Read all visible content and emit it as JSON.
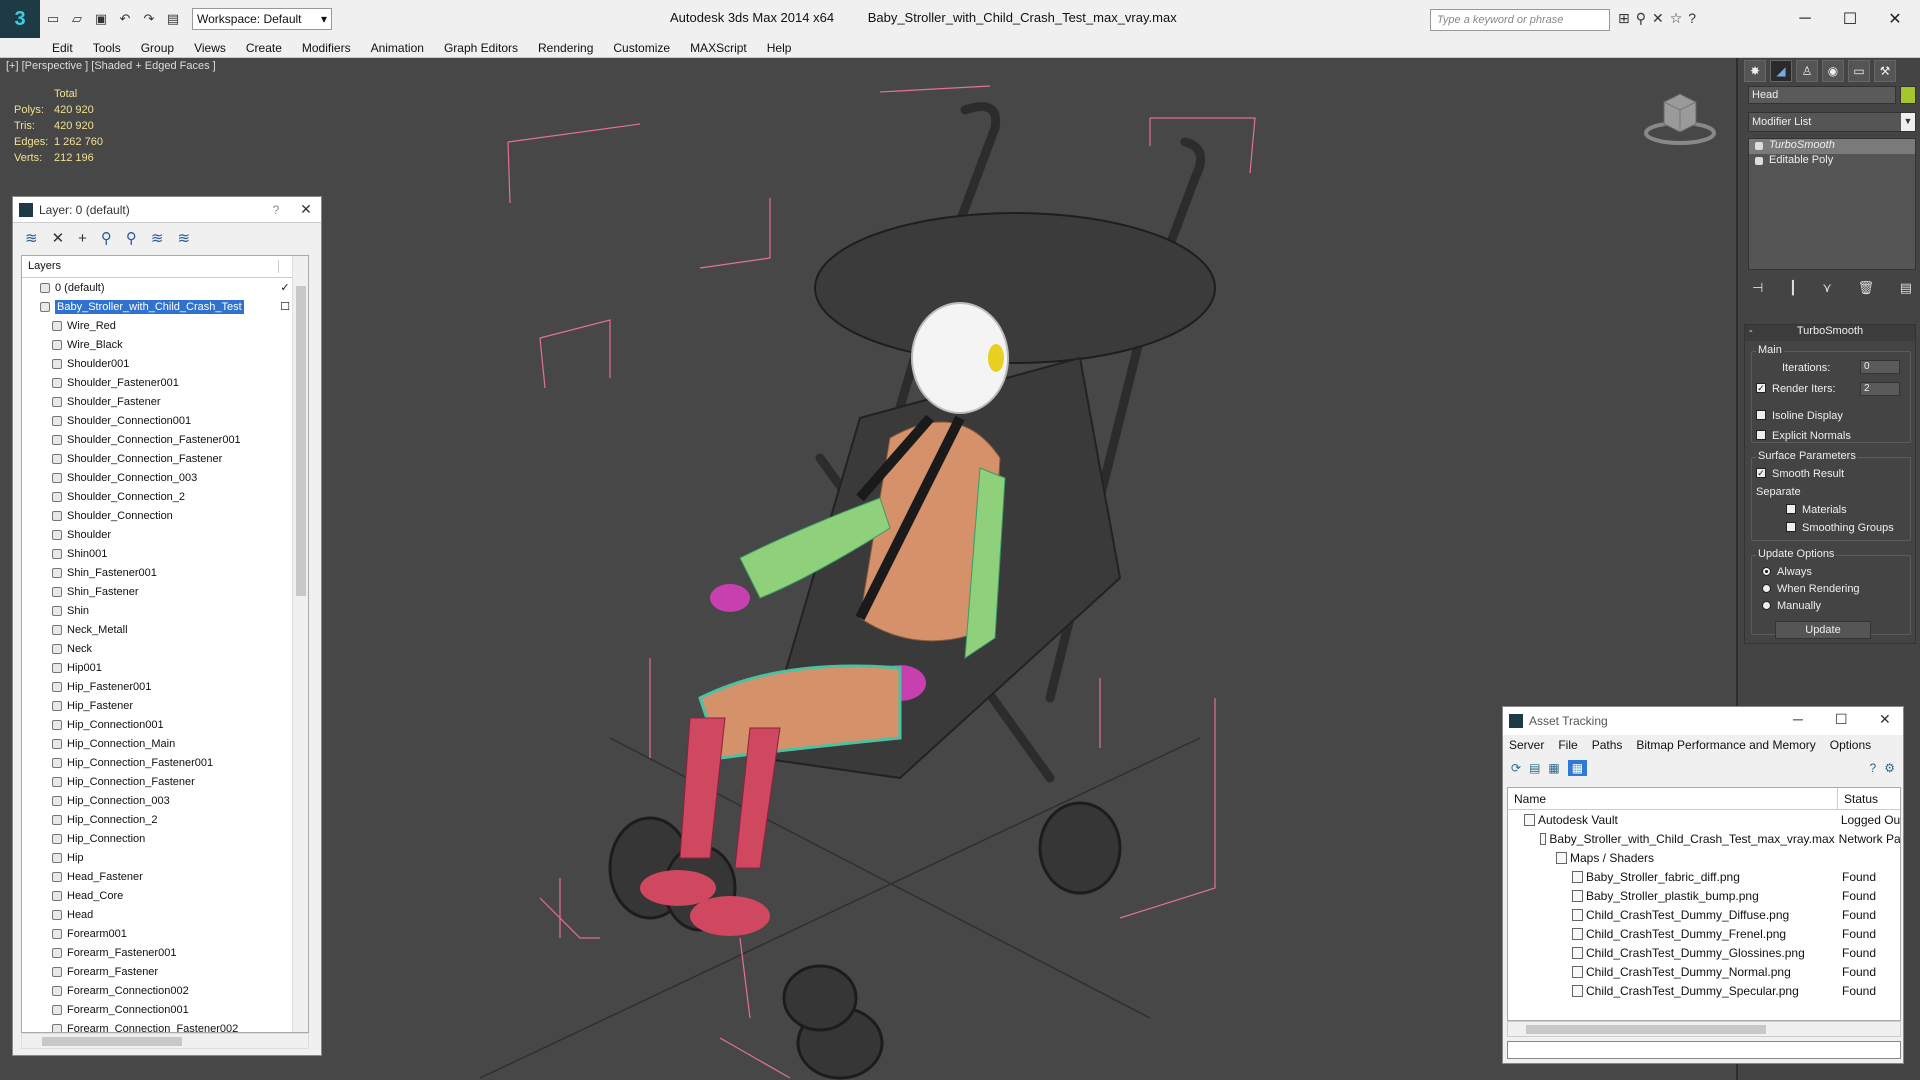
{
  "titlebar": {
    "workspace": "Workspace: Default",
    "app_name": "Autodesk 3ds Max  2014 x64",
    "file_name": "Baby_Stroller_with_Child_Crash_Test_max_vray.max",
    "search_placeholder": "Type a keyword or phrase"
  },
  "menu": [
    "Edit",
    "Tools",
    "Group",
    "Views",
    "Create",
    "Modifiers",
    "Animation",
    "Graph Editors",
    "Rendering",
    "Customize",
    "MAXScript",
    "Help"
  ],
  "viewport": {
    "label": "[+] [Perspective ] [Shaded + Edged Faces ]",
    "stats_header": "Total",
    "stats": [
      {
        "k": "Polys:",
        "v": "420 920"
      },
      {
        "k": "Tris:",
        "v": "420 920"
      },
      {
        "k": "Edges:",
        "v": "1 262 760"
      },
      {
        "k": "Verts:",
        "v": "212 196"
      }
    ]
  },
  "layer_panel": {
    "title": "Layer: 0 (default)",
    "help": "?",
    "column": "Layers",
    "items": [
      {
        "label": "0 (default)",
        "level": 1,
        "check": "✓"
      },
      {
        "label": "Baby_Stroller_with_Child_Crash_Test",
        "level": 1,
        "selected": true,
        "check": "☐"
      },
      {
        "label": "Wire_Red",
        "level": 2
      },
      {
        "label": "Wire_Black",
        "level": 2
      },
      {
        "label": "Shoulder001",
        "level": 2
      },
      {
        "label": "Shoulder_Fastener001",
        "level": 2
      },
      {
        "label": "Shoulder_Fastener",
        "level": 2
      },
      {
        "label": "Shoulder_Connection001",
        "level": 2
      },
      {
        "label": "Shoulder_Connection_Fastener001",
        "level": 2
      },
      {
        "label": "Shoulder_Connection_Fastener",
        "level": 2
      },
      {
        "label": "Shoulder_Connection_003",
        "level": 2
      },
      {
        "label": "Shoulder_Connection_2",
        "level": 2
      },
      {
        "label": "Shoulder_Connection",
        "level": 2
      },
      {
        "label": "Shoulder",
        "level": 2
      },
      {
        "label": "Shin001",
        "level": 2
      },
      {
        "label": "Shin_Fastener001",
        "level": 2
      },
      {
        "label": "Shin_Fastener",
        "level": 2
      },
      {
        "label": "Shin",
        "level": 2
      },
      {
        "label": "Neck_Metall",
        "level": 2
      },
      {
        "label": "Neck",
        "level": 2
      },
      {
        "label": "Hip001",
        "level": 2
      },
      {
        "label": "Hip_Fastener001",
        "level": 2
      },
      {
        "label": "Hip_Fastener",
        "level": 2
      },
      {
        "label": "Hip_Connection001",
        "level": 2
      },
      {
        "label": "Hip_Connection_Main",
        "level": 2
      },
      {
        "label": "Hip_Connection_Fastener001",
        "level": 2
      },
      {
        "label": "Hip_Connection_Fastener",
        "level": 2
      },
      {
        "label": "Hip_Connection_003",
        "level": 2
      },
      {
        "label": "Hip_Connection_2",
        "level": 2
      },
      {
        "label": "Hip_Connection",
        "level": 2
      },
      {
        "label": "Hip",
        "level": 2
      },
      {
        "label": "Head_Fastener",
        "level": 2
      },
      {
        "label": "Head_Core",
        "level": 2
      },
      {
        "label": "Head",
        "level": 2
      },
      {
        "label": "Forearm001",
        "level": 2
      },
      {
        "label": "Forearm_Fastener001",
        "level": 2
      },
      {
        "label": "Forearm_Fastener",
        "level": 2
      },
      {
        "label": "Forearm_Connection002",
        "level": 2
      },
      {
        "label": "Forearm_Connection001",
        "level": 2
      },
      {
        "label": "Forearm_Connection_Fastener002",
        "level": 2
      }
    ]
  },
  "command_panel": {
    "object_name": "Head",
    "object_color": "#a3c62a",
    "modifier_list": "Modifier List",
    "stack": [
      "TurboSmooth",
      "Editable Poly"
    ],
    "rollout_title": "TurboSmooth",
    "main_label": "Main",
    "iterations_label": "Iterations:",
    "iterations": "0",
    "render_iters_label": "Render Iters:",
    "render_iters": "2",
    "isoline": "Isoline Display",
    "explicit_normals": "Explicit Normals",
    "surface_params": "Surface Parameters",
    "smooth_result": "Smooth Result",
    "separate": "Separate",
    "materials": "Materials",
    "smoothing_groups": "Smoothing Groups",
    "update_options": "Update Options",
    "always": "Always",
    "when_rendering": "When Rendering",
    "manually": "Manually",
    "update": "Update"
  },
  "asset_tracking": {
    "title": "Asset Tracking",
    "menu": [
      "Server",
      "File",
      "Paths",
      "Bitmap Performance and Memory",
      "Options"
    ],
    "col_name": "Name",
    "col_status": "Status",
    "rows": [
      {
        "name": "Autodesk Vault",
        "status": "Logged Ou",
        "indent": 1
      },
      {
        "name": "Baby_Stroller_with_Child_Crash_Test_max_vray.max",
        "status": "Network Pa",
        "indent": 2
      },
      {
        "name": "Maps / Shaders",
        "status": "",
        "indent": 3
      },
      {
        "name": "Baby_Stroller_fabric_diff.png",
        "status": "Found",
        "indent": 4
      },
      {
        "name": "Baby_Stroller_plastik_bump.png",
        "status": "Found",
        "indent": 4
      },
      {
        "name": "Child_CrashTest_Dummy_Diffuse.png",
        "status": "Found",
        "indent": 4
      },
      {
        "name": "Child_CrashTest_Dummy_Frenel.png",
        "status": "Found",
        "indent": 4
      },
      {
        "name": "Child_CrashTest_Dummy_Glossines.png",
        "status": "Found",
        "indent": 4
      },
      {
        "name": "Child_CrashTest_Dummy_Normal.png",
        "status": "Found",
        "indent": 4
      },
      {
        "name": "Child_CrashTest_Dummy_Specular.png",
        "status": "Found",
        "indent": 4
      }
    ]
  }
}
